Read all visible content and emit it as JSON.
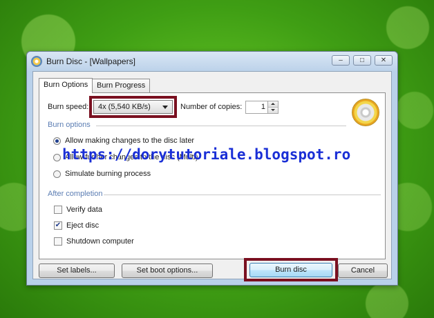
{
  "window": {
    "title": "Burn Disc - [Wallpapers]"
  },
  "tabs": [
    {
      "label": "Burn Options",
      "active": true
    },
    {
      "label": "Burn Progress",
      "active": false
    }
  ],
  "burn_speed": {
    "label": "Burn speed:",
    "selected": "4x (5,540 KB/s)"
  },
  "copies": {
    "label": "Number of copies:",
    "value": "1"
  },
  "burn_options": {
    "heading": "Burn options",
    "radios": [
      {
        "label": "Allow making changes to the disc later",
        "selected": true
      },
      {
        "label": "Allow further changes to the disc (Multi)",
        "selected": false
      },
      {
        "label": "Simulate burning process",
        "selected": false
      }
    ]
  },
  "after_completion": {
    "heading": "After completion",
    "checks": [
      {
        "label": "Verify data",
        "checked": false
      },
      {
        "label": "Eject disc",
        "checked": true
      },
      {
        "label": "Shutdown computer",
        "checked": false
      }
    ]
  },
  "buttons": {
    "set_labels": "Set labels...",
    "set_boot": "Set boot options...",
    "burn": "Burn disc",
    "cancel": "Cancel"
  },
  "watermark": "https://dorytutoriale.blogspot.ro",
  "colors": {
    "highlight": "#7a1020",
    "group_heading": "#5b7db3"
  },
  "icons": {
    "app": "burn-app-icon",
    "disc": "disc-icon"
  }
}
